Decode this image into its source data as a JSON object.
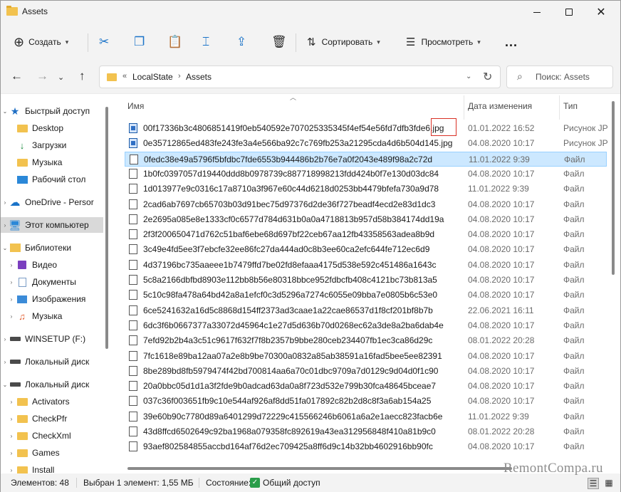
{
  "window": {
    "title": "Assets"
  },
  "toolbar": {
    "create_label": "Создать",
    "sort_label": "Сортировать",
    "view_label": "Просмотреть",
    "more_label": "..."
  },
  "address": {
    "overflow": "«",
    "crumbs": [
      "LocalState",
      "Assets"
    ],
    "separator": "›"
  },
  "search": {
    "placeholder": "Поиск: Assets"
  },
  "sidebar": {
    "items": [
      {
        "label": "Быстрый доступ",
        "icon": "star-icon"
      },
      {
        "label": "Desktop",
        "icon": "folder-icon"
      },
      {
        "label": "Загрузки",
        "icon": "download-icon"
      },
      {
        "label": "Музыка",
        "icon": "music-icon"
      },
      {
        "label": "Рабочий стол",
        "icon": "desktop-icon"
      },
      {
        "label": "OneDrive - Persor",
        "icon": "cloud-icon"
      },
      {
        "label": "Этот компьютер",
        "icon": "pc-icon"
      },
      {
        "label": "Библиотеки",
        "icon": "library-icon"
      },
      {
        "label": "Видео",
        "icon": "video-icon"
      },
      {
        "label": "Документы",
        "icon": "document-icon"
      },
      {
        "label": "Изображения",
        "icon": "image-icon"
      },
      {
        "label": "Музыка",
        "icon": "music-icon"
      },
      {
        "label": "WINSETUP (F:)",
        "icon": "drive-icon"
      },
      {
        "label": "Локальный диск",
        "icon": "drive-icon"
      },
      {
        "label": "Локальный диск",
        "icon": "drive-icon"
      },
      {
        "label": "Activators",
        "icon": "folder-icon"
      },
      {
        "label": "CheckPfr",
        "icon": "folder-icon"
      },
      {
        "label": "CheckXml",
        "icon": "folder-icon"
      },
      {
        "label": "Games",
        "icon": "folder-icon"
      },
      {
        "label": "Install",
        "icon": "folder-icon"
      }
    ]
  },
  "columns": {
    "name": "Имя",
    "date": "Дата изменения",
    "type": "Тип"
  },
  "files": [
    {
      "name_main": "00f17336b3c4806851419f0eb540592e707025335345f4ef54e56fd7dfb3fde6",
      "name_ext": ".jpg",
      "date": "01.01.2022 16:52",
      "type": "Рисунок JPEG",
      "kind": "jpg"
    },
    {
      "name_main": "0e35712865ed483fe243fe3a4e566ba92c7c769fb253a21295cda4d6b504d145",
      "name_ext": ".jpg",
      "date": "04.08.2020 10:17",
      "type": "Рисунок JPEG",
      "kind": "jpg"
    },
    {
      "name_main": "0fedc38e49a5796f5bfdbc7fde6553b944486b2b76e7a0f2043e489f98a2c72d",
      "name_ext": "",
      "date": "11.01.2022 9:39",
      "type": "Файл",
      "kind": "file"
    },
    {
      "name_main": "1b0fc0397057d19440ddd8b0978739c887718998213fdd424b0f7e130d03dc84",
      "name_ext": "",
      "date": "04.08.2020 10:17",
      "type": "Файл",
      "kind": "file"
    },
    {
      "name_main": "1d013977e9c0316c17a8710a3f967e60c44d6218d0253bb4479bfefa730a9d78",
      "name_ext": "",
      "date": "11.01.2022 9:39",
      "type": "Файл",
      "kind": "file"
    },
    {
      "name_main": "2cad6ab7697cb65703b03d91bec75d97376d2de36f727beadf4ecd2e83d1dc3",
      "name_ext": "",
      "date": "04.08.2020 10:17",
      "type": "Файл",
      "kind": "file"
    },
    {
      "name_main": "2e2695a085e8e1333cf0c6577d784d631b0a0a4718813b957d58b384174dd19a",
      "name_ext": "",
      "date": "04.08.2020 10:17",
      "type": "Файл",
      "kind": "file"
    },
    {
      "name_main": "2f3f200650471d762c51baf6ebe68d697bf22ceb67aa12fb43358563adea8b9d",
      "name_ext": "",
      "date": "04.08.2020 10:17",
      "type": "Файл",
      "kind": "file"
    },
    {
      "name_main": "3c49e4fd5ee3f7ebcfe32ee86fc27da444ad0c8b3ee60ca2efc644fe712ec6d9",
      "name_ext": "",
      "date": "04.08.2020 10:17",
      "type": "Файл",
      "kind": "file"
    },
    {
      "name_main": "4d37196bc735aaeee1b7479ffd7be02fd8efaaa4175d538e592c451486a1643c",
      "name_ext": "",
      "date": "04.08.2020 10:17",
      "type": "Файл",
      "kind": "file"
    },
    {
      "name_main": "5c8a2166dbfbd8903e112bb8b56e80318bbce952fdbcfb408c4121bc73b813a5",
      "name_ext": "",
      "date": "04.08.2020 10:17",
      "type": "Файл",
      "kind": "file"
    },
    {
      "name_main": "5c10c98fa478a64bd42a8a1efcf0c3d5296a7274c6055e09bba7e0805b6c53e0",
      "name_ext": "",
      "date": "04.08.2020 10:17",
      "type": "Файл",
      "kind": "file"
    },
    {
      "name_main": "6ce5241632a16d5c8868d154ff2373ad3caae1a22cae86537d1f8cf201bf8b7b",
      "name_ext": "",
      "date": "22.06.2021 16:11",
      "type": "Файл",
      "kind": "file"
    },
    {
      "name_main": "6dc3f6b0667377a33072d45964c1e27d5d636b70d0268ec62a3de8a2ba6dab4e",
      "name_ext": "",
      "date": "04.08.2020 10:17",
      "type": "Файл",
      "kind": "file"
    },
    {
      "name_main": "7efd92b2b4a3c51c9617f632f7f8b2357b9bbe280ceb234407fb1ec3ca86d29c",
      "name_ext": "",
      "date": "08.01.2022 20:28",
      "type": "Файл",
      "kind": "file"
    },
    {
      "name_main": "7fc1618e89ba12aa07a2e8b9be70300a0832a85ab38591a16fad5bee5ee82391",
      "name_ext": "",
      "date": "04.08.2020 10:17",
      "type": "Файл",
      "kind": "file"
    },
    {
      "name_main": "8be289bd8fb5979474f42bd700814aa6a70c01dbc9709a7d0129c9d04d0f1c90",
      "name_ext": "",
      "date": "04.08.2020 10:17",
      "type": "Файл",
      "kind": "file"
    },
    {
      "name_main": "20a0bbc05d1d1a3f2fde9b0adcad63da0a8f723d532e799b30fca48645bceae7",
      "name_ext": "",
      "date": "04.08.2020 10:17",
      "type": "Файл",
      "kind": "file"
    },
    {
      "name_main": "037c36f003651fb9c10e544af926af8dd51fa017892c82b2d8c8f3a6ab154a25",
      "name_ext": "",
      "date": "04.08.2020 10:17",
      "type": "Файл",
      "kind": "file"
    },
    {
      "name_main": "39e60b90c7780d89a6401299d72229c415566246b6061a6a2e1aecc823facb6e",
      "name_ext": "",
      "date": "11.01.2022 9:39",
      "type": "Файл",
      "kind": "file"
    },
    {
      "name_main": "43d8ffcd6502649c92ba1968a079358fc892619a43ea312956848f410a81b9c0",
      "name_ext": "",
      "date": "08.01.2022 20:28",
      "type": "Файл",
      "kind": "file"
    },
    {
      "name_main": "93aef802584855accbd164af76d2ec709425a8ff6d9c14b32bb4602916bb90fc",
      "name_ext": "",
      "date": "04.08.2020 10:17",
      "type": "Файл",
      "kind": "file"
    }
  ],
  "status": {
    "count": "Элементов: 48",
    "selection": "Выбран 1 элемент: 1,55 МБ",
    "state_label": "Состояние:",
    "state_value": "Общий доступ"
  },
  "watermark": "RemontCompa.ru",
  "colors": {
    "selection_bg": "#cce8ff",
    "selection_border": "#99d1ff",
    "folder": "#f2c24f",
    "highlight_box": "#d93025",
    "accent": "#1a73c8"
  }
}
